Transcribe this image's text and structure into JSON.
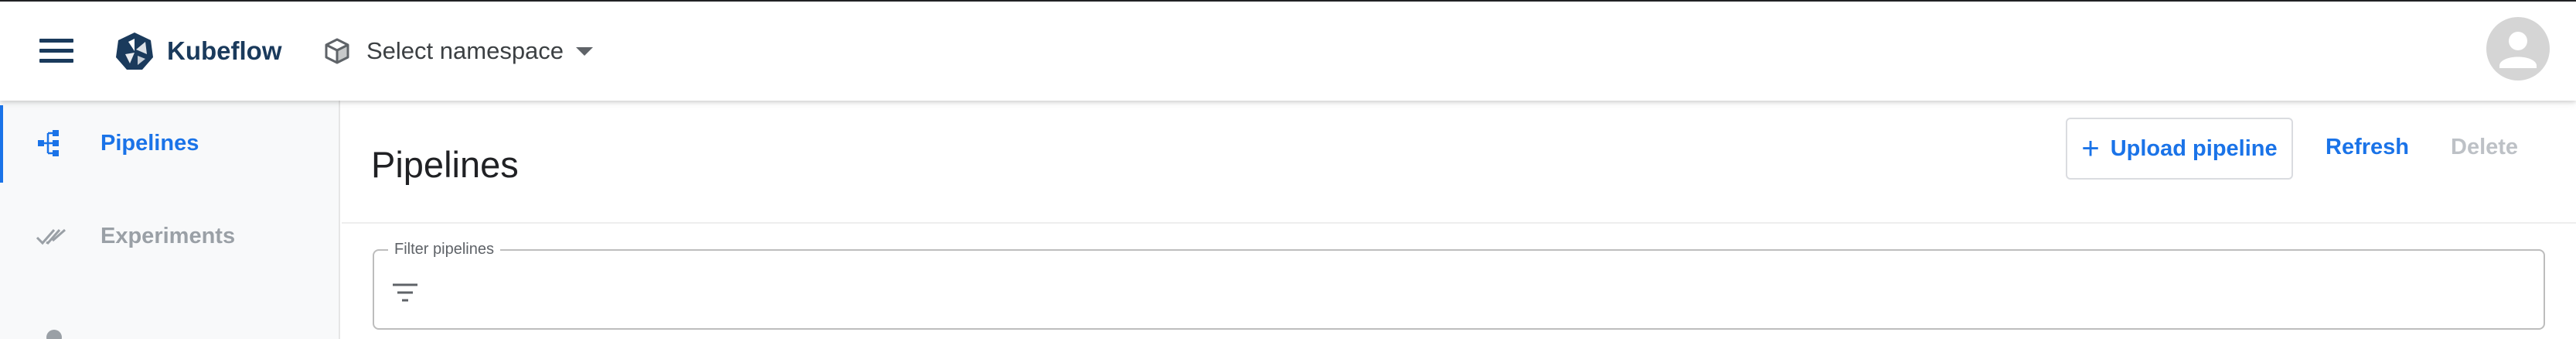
{
  "app": {
    "brand": "Kubeflow",
    "namespace_label": "Select namespace"
  },
  "icons": {
    "menu": "menu-icon",
    "logo": "kubeflow-logo",
    "namespace": "cube-icon",
    "caret": "caret-down-icon",
    "avatar": "account-icon",
    "pipelines": "pipeline-icon",
    "experiments": "double-check-icon",
    "filter": "filter-list-icon",
    "upload": "plus-icon"
  },
  "sidebar": {
    "items": [
      {
        "label": "Pipelines",
        "active": true
      },
      {
        "label": "Experiments",
        "active": false
      }
    ]
  },
  "main": {
    "title": "Pipelines",
    "upload_label": "Upload pipeline",
    "refresh_label": "Refresh",
    "delete_label": "Delete",
    "filter_label": "Filter pipelines",
    "filter_value": ""
  },
  "colors": {
    "accent": "#1a73e8",
    "brand": "#1a3a5c",
    "disabled": "#bdc1c6",
    "muted": "#9aa0a6"
  }
}
